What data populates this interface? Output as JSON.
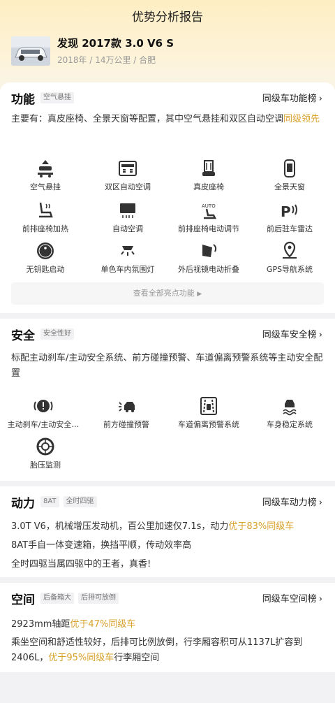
{
  "header": {
    "title": "优势分析报告"
  },
  "car": {
    "name": "发现 2017款 3.0 V6 S",
    "meta": "2018年 / 14万公里 / 合肥"
  },
  "colors": {
    "accent": "#d8a12a",
    "hero": "#fdeec3"
  },
  "functions": {
    "title": "功能",
    "tags": [
      "空气悬挂"
    ],
    "rank_link": "同级车功能榜",
    "summary_a": "主要有：真皮座椅、全景天窗等配置，其中空气悬挂和双区自动空调",
    "summary_hl": "同级领先",
    "items": [
      {
        "label": "空气悬挂",
        "icon": "air-suspension-icon"
      },
      {
        "label": "双区自动空调",
        "icon": "dual-zone-ac-icon"
      },
      {
        "label": "真皮座椅",
        "icon": "leather-seat-icon"
      },
      {
        "label": "全景天窗",
        "icon": "panoramic-sunroof-icon"
      },
      {
        "label": "前排座椅加热",
        "icon": "seat-heating-icon"
      },
      {
        "label": "自动空调",
        "icon": "auto-ac-icon"
      },
      {
        "label": "前排座椅电动调节",
        "icon": "power-seat-icon"
      },
      {
        "label": "前后驻车雷达",
        "icon": "parking-radar-icon"
      },
      {
        "label": "无钥匙启动",
        "icon": "keyless-start-icon"
      },
      {
        "label": "单色车内氛围灯",
        "icon": "ambient-light-icon"
      },
      {
        "label": "外后视镜电动折叠",
        "icon": "mirror-fold-icon"
      },
      {
        "label": "GPS导航系统",
        "icon": "gps-navigation-icon"
      }
    ],
    "view_all": "查看全部亮点功能"
  },
  "safety": {
    "title": "安全",
    "tags": [
      "安全性好"
    ],
    "rank_link": "同级车安全榜",
    "summary": "标配主动刹车/主动安全系统、前方碰撞预警、车道偏离预警系统等主动安全配置",
    "items": [
      {
        "label": "主动刹车/主动安全…",
        "icon": "active-brake-icon"
      },
      {
        "label": "前方碰撞预警",
        "icon": "collision-warning-icon"
      },
      {
        "label": "车道偏离预警系统",
        "icon": "lane-departure-icon"
      },
      {
        "label": "车身稳定系统",
        "icon": "stability-control-icon"
      },
      {
        "label": "胎压监测",
        "icon": "tire-pressure-icon"
      }
    ]
  },
  "power": {
    "title": "动力",
    "tags": [
      "8AT",
      "全时四驱"
    ],
    "rank_link": "同级车动力榜",
    "line1_a": "3.0T V6，机械增压发动机，百公里加速仅7.1s，动力",
    "line1_hl": "优于83%同级车",
    "line2": "8AT手自一体变速箱，换挡平顺，传动效率高",
    "line3": "全时四驱当属四驱中的王者，真香!"
  },
  "space": {
    "title": "空间",
    "tags": [
      "后备箱大",
      "后排可放倒"
    ],
    "rank_link": "同级车空间榜",
    "line1_a": "2923mm轴距",
    "line1_hl": "优于47%同级车",
    "line2": "乘坐空间和舒适性较好，后排可比例放倒，行李厢容积可从1137L扩容到",
    "line3_a": "2406L，",
    "line3_hl": "优于95%同级车",
    "line3_b": "行李厢空间"
  }
}
